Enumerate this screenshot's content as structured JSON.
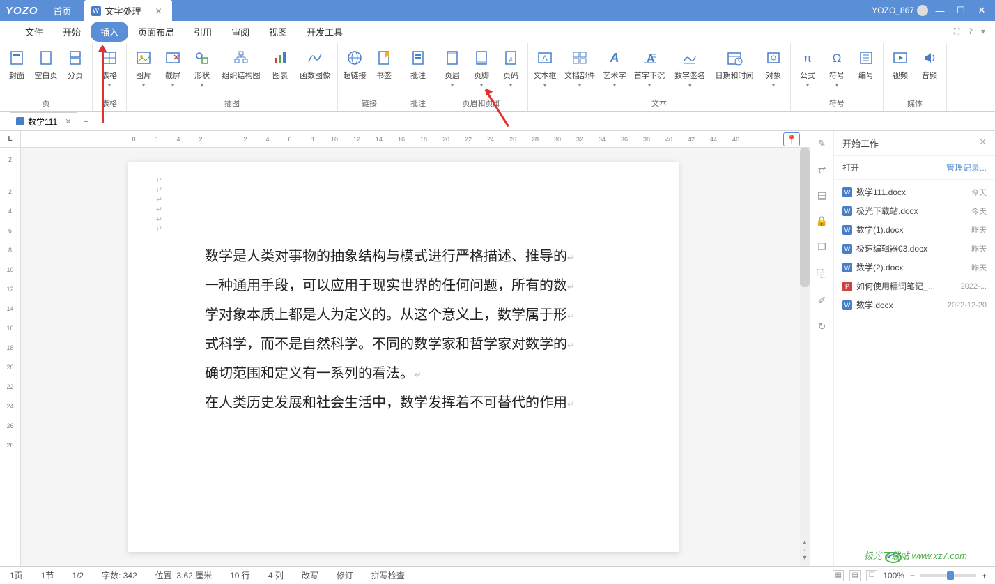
{
  "titlebar": {
    "logo": "YOZO",
    "home": "首页",
    "doctab": "文字处理",
    "user": "YOZO_867"
  },
  "menu": {
    "items": [
      "文件",
      "开始",
      "插入",
      "页面布局",
      "引用",
      "审阅",
      "视图",
      "开发工具"
    ],
    "active_index": 2
  },
  "ribbon": {
    "groups": [
      {
        "label": "页",
        "items": [
          {
            "label": "封面",
            "icon": "cover"
          },
          {
            "label": "空白页",
            "icon": "blank"
          },
          {
            "label": "分页",
            "icon": "break"
          }
        ]
      },
      {
        "label": "表格",
        "items": [
          {
            "label": "表格",
            "icon": "table",
            "dd": true
          }
        ]
      },
      {
        "label": "插图",
        "items": [
          {
            "label": "图片",
            "icon": "image",
            "dd": true
          },
          {
            "label": "截屏",
            "icon": "screenshot",
            "dd": true
          },
          {
            "label": "形状",
            "icon": "shapes",
            "dd": true
          },
          {
            "label": "组织结构图",
            "icon": "org"
          },
          {
            "label": "图表",
            "icon": "chart"
          },
          {
            "label": "函数图像",
            "icon": "function"
          }
        ]
      },
      {
        "label": "链接",
        "items": [
          {
            "label": "超链接",
            "icon": "link"
          },
          {
            "label": "书签",
            "icon": "bookmark"
          }
        ]
      },
      {
        "label": "批注",
        "items": [
          {
            "label": "批注",
            "icon": "comment"
          }
        ]
      },
      {
        "label": "页眉和页脚",
        "items": [
          {
            "label": "页眉",
            "icon": "header",
            "dd": true
          },
          {
            "label": "页脚",
            "icon": "footer",
            "dd": true
          },
          {
            "label": "页码",
            "icon": "pagenum",
            "dd": true
          }
        ]
      },
      {
        "label": "文本",
        "items": [
          {
            "label": "文本框",
            "icon": "textbox",
            "dd": true
          },
          {
            "label": "文档部件",
            "icon": "parts",
            "dd": true
          },
          {
            "label": "艺术字",
            "icon": "wordart",
            "dd": true
          },
          {
            "label": "首字下沉",
            "icon": "dropcap",
            "dd": true
          },
          {
            "label": "数字签名",
            "icon": "signature",
            "dd": true
          },
          {
            "label": "日期和时间",
            "icon": "datetime"
          },
          {
            "label": "对象",
            "icon": "object",
            "dd": true
          }
        ]
      },
      {
        "label": "符号",
        "items": [
          {
            "label": "公式",
            "icon": "formula",
            "dd": true
          },
          {
            "label": "符号",
            "icon": "symbol",
            "dd": true
          },
          {
            "label": "编号",
            "icon": "number"
          }
        ]
      },
      {
        "label": "媒体",
        "items": [
          {
            "label": "视频",
            "icon": "video"
          },
          {
            "label": "音频",
            "icon": "audio"
          }
        ]
      }
    ]
  },
  "doctabs": {
    "name": "数学111"
  },
  "ruler": {
    "h": [
      "8",
      "6",
      "4",
      "2",
      "",
      "2",
      "4",
      "6",
      "8",
      "10",
      "12",
      "14",
      "16",
      "18",
      "20",
      "22",
      "24",
      "26",
      "28",
      "30",
      "32",
      "34",
      "36",
      "38",
      "40",
      "42",
      "44",
      "46"
    ],
    "v": [
      "2",
      "",
      "2",
      "4",
      "6",
      "8",
      "10",
      "12",
      "14",
      "16",
      "18",
      "20",
      "22",
      "24",
      "26",
      "28"
    ]
  },
  "document": {
    "paragraphs": [
      "数学是人类对事物的抽象结构与模式进行严格描述、推导的",
      "一种通用手段，可以应用于现实世界的任何问题，所有的数",
      "学对象本质上都是人为定义的。从这个意义上，数学属于形",
      "式科学，而不是自然科学。不同的数学家和哲学家对数学的",
      "确切范围和定义有一系列的看法。",
      "在人类历史发展和社会生活中，数学发挥着不可替代的作用"
    ]
  },
  "sidepanel": {
    "title": "开始工作",
    "open_label": "打开",
    "manage_label": "管理记录...",
    "files": [
      {
        "name": "数学111.docx",
        "date": "今天",
        "type": "doc"
      },
      {
        "name": "极光下载站.docx",
        "date": "今天",
        "type": "doc"
      },
      {
        "name": "数学(1).docx",
        "date": "昨天",
        "type": "doc"
      },
      {
        "name": "极速编辑器03.docx",
        "date": "昨天",
        "type": "doc"
      },
      {
        "name": "数学(2).docx",
        "date": "昨天",
        "type": "doc"
      },
      {
        "name": "如何使用糯词笔记_...",
        "date": "2022-...",
        "type": "pdf"
      },
      {
        "name": "数学.docx",
        "date": "2022-12-20",
        "type": "doc"
      }
    ]
  },
  "statusbar": {
    "page": "1页",
    "section": "1节",
    "pages": "1/2",
    "wordcount": "字数: 342",
    "position": "位置: 3.62 厘米",
    "line": "10 行",
    "column": "4 列",
    "overwrite": "改写",
    "revise": "修订",
    "spellcheck": "拼写检查",
    "zoom": "100%"
  },
  "watermark": "极光下载站 www.xz7.com"
}
